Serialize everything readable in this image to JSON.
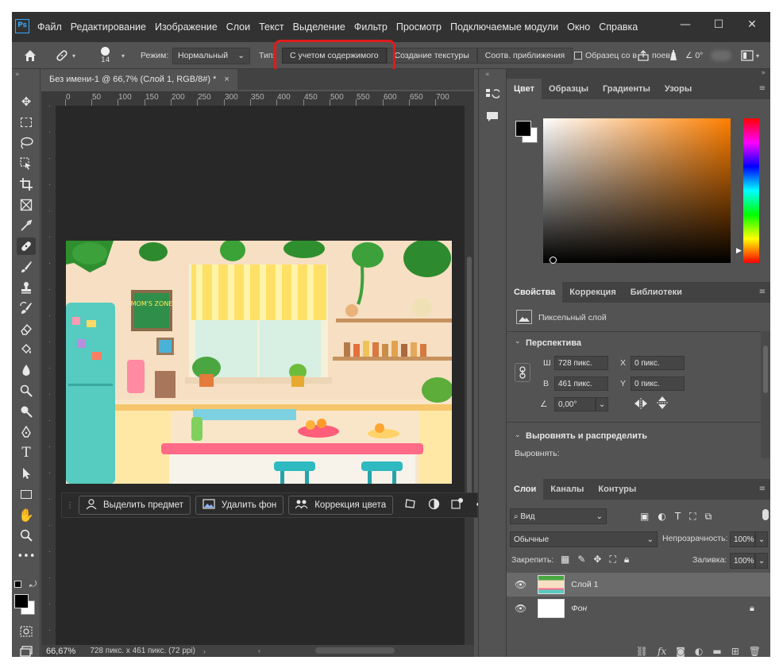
{
  "app": {
    "logo": "Ps"
  },
  "menu": [
    "Файл",
    "Редактирование",
    "Изображение",
    "Слои",
    "Текст",
    "Выделение",
    "Фильтр",
    "Просмотр",
    "Подключаемые модули",
    "Окно",
    "Справка"
  ],
  "window_controls": {
    "minimize": "—",
    "maximize": "☐",
    "close": "✕"
  },
  "options": {
    "brush_size": "14",
    "mode_label": "Режим:",
    "mode_value": "Нормальный",
    "type_label": "Тип:",
    "type_segments": [
      "С учетом содержимого",
      "Создание текстуры",
      "Соотв. приближения"
    ],
    "sample_all_label": "Образец со в",
    "pressure_label": "поев",
    "angle_label": "∠ 0°"
  },
  "document": {
    "tab_title": "Без имени-1 @ 66,7% (Слой 1, RGB/8#) *",
    "close": "×",
    "ruler_marks": [
      "0",
      "50",
      "100",
      "150",
      "200",
      "250",
      "300",
      "350",
      "400",
      "450",
      "500",
      "550",
      "600",
      "650",
      "700"
    ],
    "zoom": "66,67%",
    "doc_info": "728 пикс. x 461 пикс. (72 ppi)"
  },
  "context_bar": {
    "select_subject": "Выделить предмет",
    "remove_bg": "Удалить фон",
    "color_correction": "Коррекция цвета",
    "more": "•••"
  },
  "image": {
    "board_text": "MOM'S ZONE"
  },
  "color_panel": {
    "tabs": [
      "Цвет",
      "Образцы",
      "Градиенты",
      "Узоры"
    ],
    "fg_color": "#000000",
    "bg_color": "#ffffff",
    "hue_color": "#ff7f00"
  },
  "properties_panel": {
    "tabs": [
      "Свойства",
      "Коррекция",
      "Библиотеки"
    ],
    "layer_type": "Пиксельный слой",
    "perspective_title": "Перспектива",
    "w_label": "Ш",
    "w_value": "728 пикс.",
    "h_label": "В",
    "h_value": "461 пикс.",
    "x_label": "X",
    "x_value": "0 пикс.",
    "y_label": "Y",
    "y_value": "0 пикс.",
    "angle_value": "0,00°",
    "align_title": "Выровнять и распределить",
    "align_label": "Выровнять:"
  },
  "layers_panel": {
    "tabs": [
      "Слои",
      "Каналы",
      "Контуры"
    ],
    "filter_label": "Вид",
    "blend_mode": "Обычные",
    "opacity_label": "Непрозрачность:",
    "opacity_value": "100%",
    "lock_label": "Закрепить:",
    "fill_label": "Заливка:",
    "fill_value": "100%",
    "layers": [
      {
        "name": "Слой 1",
        "selected": true
      },
      {
        "name": "Фон",
        "selected": false
      }
    ]
  }
}
